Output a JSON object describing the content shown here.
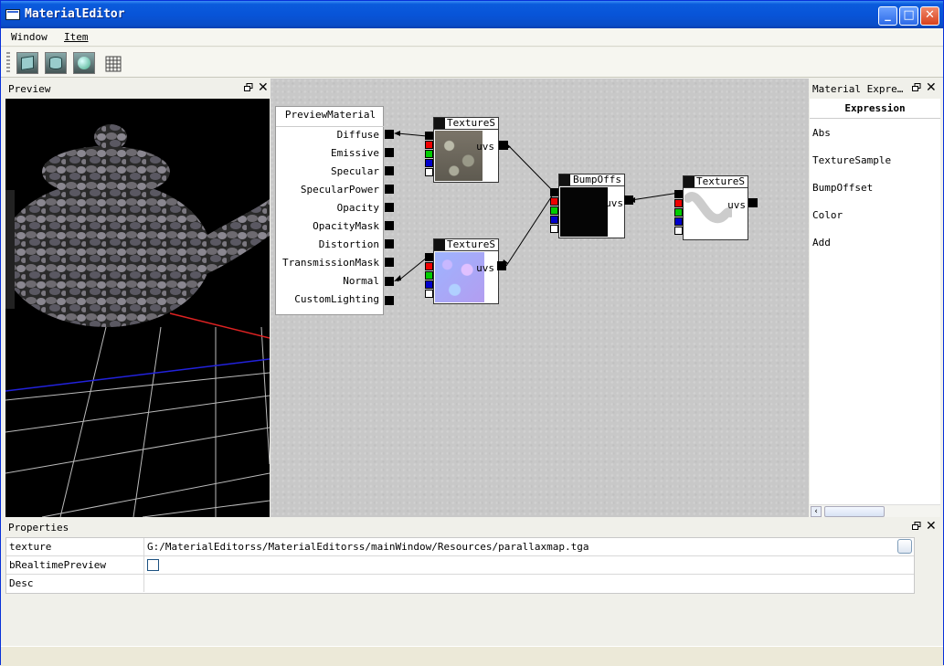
{
  "window": {
    "title": "MaterialEditor",
    "minimize_glyph": "_",
    "maximize_glyph": "□",
    "close_glyph": "✕"
  },
  "menu": {
    "items": [
      "Window",
      "Item"
    ]
  },
  "toolbar": {
    "tools": [
      "cube-icon",
      "cylinder-icon",
      "sphere-icon",
      "grid-icon"
    ]
  },
  "preview_panel": {
    "title": "Preview"
  },
  "graph": {
    "preview_material": {
      "title": "PreviewMaterial",
      "inputs": [
        "Diffuse",
        "Emissive",
        "Specular",
        "SpecularPower",
        "Opacity",
        "OpacityMask",
        "Distortion",
        "TransmissionMask",
        "Normal",
        "CustomLighting"
      ]
    },
    "nodes": [
      {
        "title": "TextureS",
        "output": "uvs"
      },
      {
        "title": "TextureS",
        "output": "uvs"
      },
      {
        "title": "BumpOffs",
        "output": "uvs"
      },
      {
        "title": "TextureS",
        "output": "uvs"
      }
    ]
  },
  "expression_panel": {
    "title": "Material Expre…",
    "header": "Expression",
    "items": [
      "Abs",
      "TextureSample",
      "BumpOffset",
      "Color",
      "Add"
    ]
  },
  "properties_panel": {
    "title": "Properties",
    "rows": [
      {
        "name": "texture",
        "value": "G:/MaterialEditorss/MaterialEditorss/mainWindow/Resources/parallaxmap.tga"
      },
      {
        "name": "bRealtimePreview",
        "value": ""
      },
      {
        "name": "Desc",
        "value": ""
      }
    ]
  },
  "colors": {
    "titlebar": "#0854d8",
    "graph_bg": "#c8c8c8",
    "pin_red": "#ee0000",
    "pin_green": "#00cc00",
    "pin_blue": "#0000cc"
  }
}
